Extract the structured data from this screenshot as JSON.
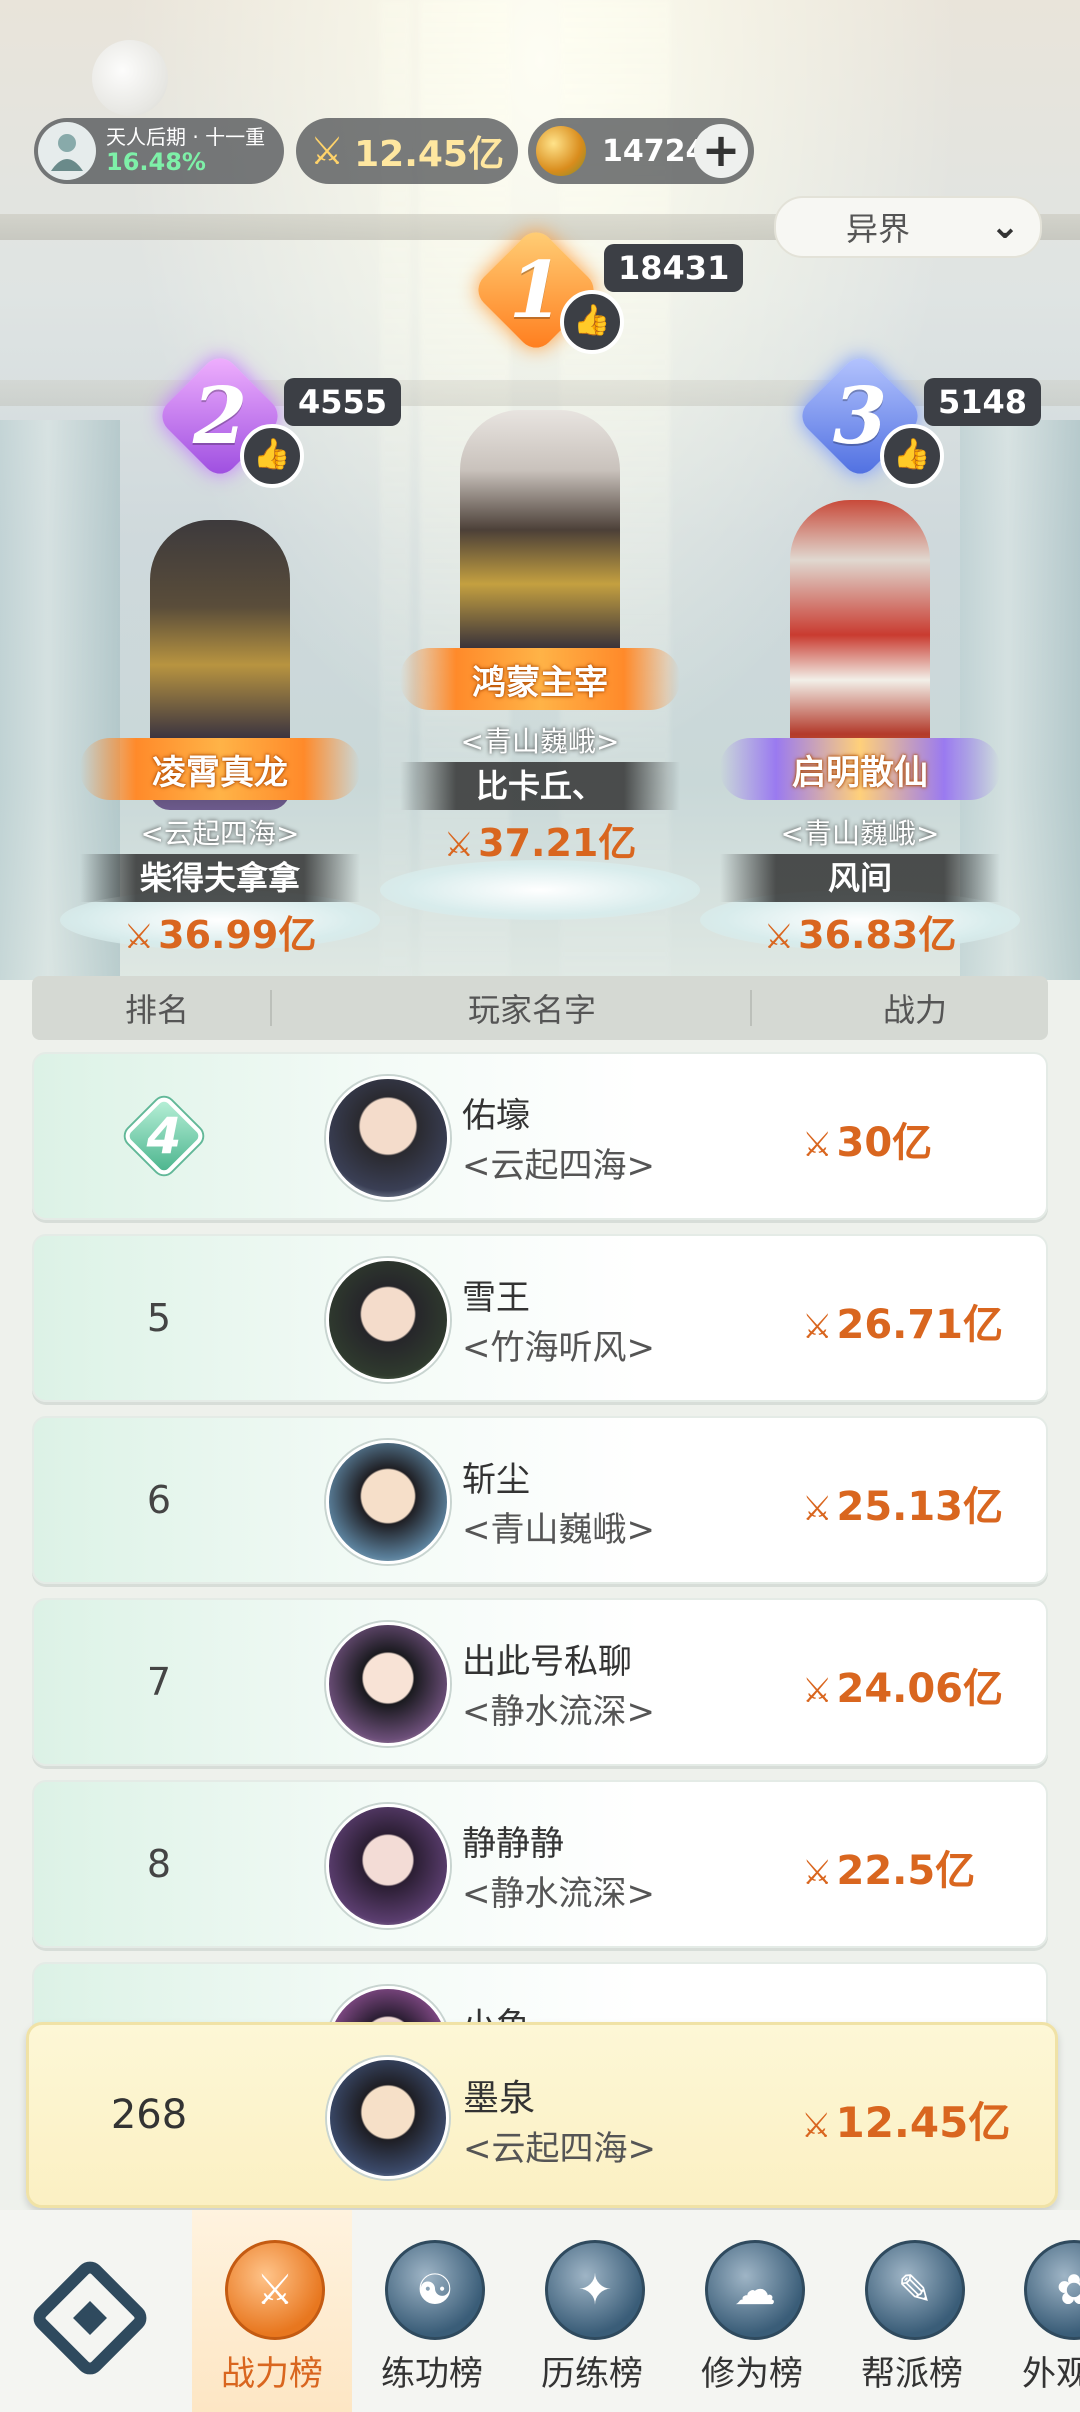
{
  "status": {
    "realm": "天人后期 · 十一重",
    "exp_percent": "16.48%",
    "power": "12.45亿",
    "coins": "14724",
    "plus": "+"
  },
  "realm_select": {
    "label": "异界",
    "chevron": "⌄"
  },
  "podium": [
    {
      "rank": "1",
      "likes": "18431",
      "title": "鸿蒙主宰",
      "guild": "<青山巍峨>",
      "name": "比卡丘、",
      "power": "37.21亿"
    },
    {
      "rank": "2",
      "likes": "4555",
      "title": "凌霄真龙",
      "guild": "<云起四海>",
      "name": "柴得夫拿拿",
      "power": "36.99亿"
    },
    {
      "rank": "3",
      "likes": "5148",
      "title": "启明散仙",
      "guild": "<青山巍峨>",
      "name": "风间",
      "power": "36.83亿"
    }
  ],
  "table_header": {
    "rank": "排名",
    "name": "玩家名字",
    "power": "战力"
  },
  "rows": [
    {
      "rank": "4",
      "name": "佑壕",
      "guild": "<云起四海>",
      "power": "30亿"
    },
    {
      "rank": "5",
      "name": "雪王",
      "guild": "<竹海听风>",
      "power": "26.71亿"
    },
    {
      "rank": "6",
      "name": "斩尘",
      "guild": "<青山巍峨>",
      "power": "25.13亿"
    },
    {
      "rank": "7",
      "name": "出此号私聊",
      "guild": "<静水流深>",
      "power": "24.06亿"
    },
    {
      "rank": "8",
      "name": "静静静",
      "guild": "<静水流深>",
      "power": "22.5亿"
    }
  ],
  "partial_row_name": "小鱼",
  "my_row": {
    "rank": "268",
    "name": "墨泉",
    "guild": "<云起四海>",
    "power": "12.45亿"
  },
  "nav": [
    {
      "label": "战力榜",
      "icon": "⚔"
    },
    {
      "label": "练功榜",
      "icon": "☯"
    },
    {
      "label": "历练榜",
      "icon": "✦"
    },
    {
      "label": "修为榜",
      "icon": "☁"
    },
    {
      "label": "帮派榜",
      "icon": "✎"
    },
    {
      "label": "外观",
      "icon": "✿"
    }
  ],
  "colors": {
    "power": "#d9661f",
    "accent_green": "#4bb48d",
    "my_row_bg": "#fbf0c3"
  }
}
